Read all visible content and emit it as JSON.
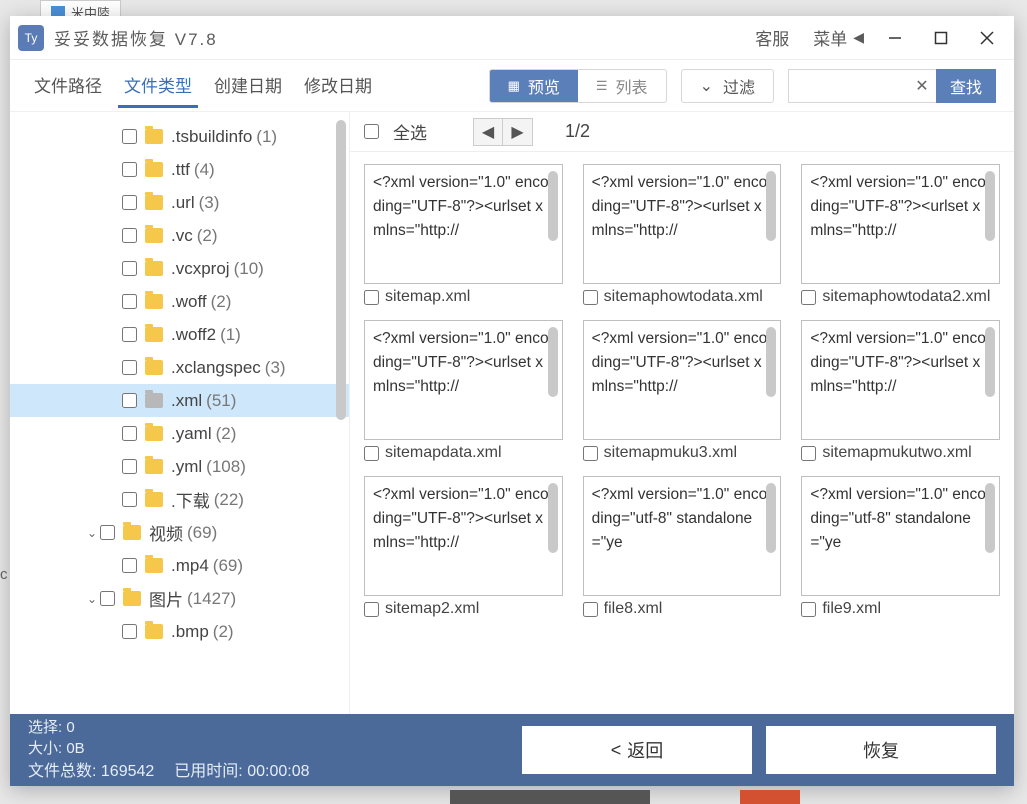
{
  "titlebar": {
    "app_name": "妥妥数据恢复",
    "version": "V7.8",
    "customer_service": "客服",
    "menu": "菜单"
  },
  "toolbar": {
    "tabs": [
      "文件路径",
      "文件类型",
      "创建日期",
      "修改日期"
    ],
    "active_tab_index": 1,
    "preview": "预览",
    "list": "列表",
    "filter": "过滤",
    "search_btn": "查找"
  },
  "content_head": {
    "select_all": "全选",
    "page_indicator": "1/2"
  },
  "tree": {
    "items": [
      {
        "level": 2,
        "name": ".tsbuildinfo",
        "count": "(1)"
      },
      {
        "level": 2,
        "name": ".ttf",
        "count": "(4)"
      },
      {
        "level": 2,
        "name": ".url",
        "count": "(3)"
      },
      {
        "level": 2,
        "name": ".vc",
        "count": "(2)"
      },
      {
        "level": 2,
        "name": ".vcxproj",
        "count": "(10)"
      },
      {
        "level": 2,
        "name": ".woff",
        "count": "(2)"
      },
      {
        "level": 2,
        "name": ".woff2",
        "count": "(1)"
      },
      {
        "level": 2,
        "name": ".xclangspec",
        "count": "(3)"
      },
      {
        "level": 2,
        "name": ".xml",
        "count": "(51)",
        "selected": true,
        "grey": true
      },
      {
        "level": 2,
        "name": ".yaml",
        "count": "(2)"
      },
      {
        "level": 2,
        "name": ".yml",
        "count": "(108)"
      },
      {
        "level": 2,
        "name": ".下载",
        "count": "(22)"
      },
      {
        "level": 1,
        "name": "视频",
        "count": "(69)",
        "caret": true
      },
      {
        "level": 2,
        "name": ".mp4",
        "count": "(69)"
      },
      {
        "level": 1,
        "name": "图片",
        "count": "(1427)",
        "caret": true
      },
      {
        "level": 2,
        "name": ".bmp",
        "count": "(2)"
      }
    ]
  },
  "cards": [
    {
      "preview": "<?xml version=\"1.0\" encoding=\"UTF-8\"?><urlset xmlns=\"http://",
      "name": "sitemap.xml"
    },
    {
      "preview": "<?xml version=\"1.0\" encoding=\"UTF-8\"?><urlset xmlns=\"http://",
      "name": "sitemaphowtodata.xml"
    },
    {
      "preview": "<?xml version=\"1.0\" encoding=\"UTF-8\"?><urlset xmlns=\"http://",
      "name": "sitemaphowtodata2.xml"
    },
    {
      "preview": "<?xml version=\"1.0\" encoding=\"UTF-8\"?><urlset xmlns=\"http://",
      "name": "sitemapdata.xml"
    },
    {
      "preview": "<?xml version=\"1.0\" encoding=\"UTF-8\"?><urlset xmlns=\"http://",
      "name": "sitemapmuku3.xml"
    },
    {
      "preview": "<?xml version=\"1.0\" encoding=\"UTF-8\"?><urlset xmlns=\"http://",
      "name": "sitemapmukutwo.xml"
    },
    {
      "preview": "<?xml version=\"1.0\" encoding=\"UTF-8\"?><urlset xmlns=\"http://",
      "name": "sitemap2.xml"
    },
    {
      "preview": "<?xml version=\"1.0\" encoding=\"utf-8\" standalone=\"ye",
      "name": "file8.xml"
    },
    {
      "preview": "<?xml version=\"1.0\" encoding=\"utf-8\" standalone=\"ye",
      "name": "file9.xml"
    }
  ],
  "footer": {
    "selected_label": "选择:",
    "selected_value": "0",
    "size_label": "大小:",
    "size_value": "0B",
    "total_label": "文件总数:",
    "total_value": "169542",
    "elapsed_label": "已用时间:",
    "elapsed_value": "00:00:08",
    "back": "返回",
    "recover": "恢复"
  },
  "remnant_tab": "米中陸"
}
